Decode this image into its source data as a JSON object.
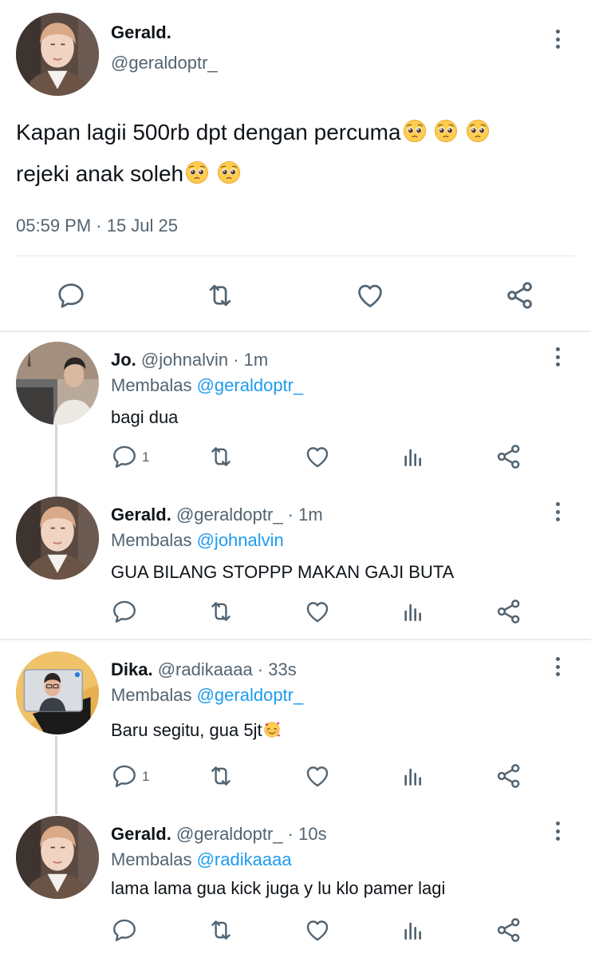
{
  "main_tweet": {
    "name": "Gerald.",
    "handle": "@geraldoptr_",
    "line1": "Kapan lagii 500rb dpt dengan percuma",
    "line2": "rejeki anak soleh",
    "line1_emoji": [
      "pleading-face",
      "pleading-face",
      "pleading-face"
    ],
    "line2_emoji": [
      "pleading-face",
      "pleading-face"
    ],
    "timestamp": "05:59 PM · 15 Jul 25",
    "actions": [
      "reply-icon",
      "retweet-icon",
      "like-icon",
      "share-icon"
    ]
  },
  "replies": [
    {
      "name": "Jo.",
      "meta": "@johnalvin · 1m",
      "replying_label": "Membalas ",
      "replying_to": "@geraldoptr_",
      "text": "bagi dua",
      "reply_count": "1"
    },
    {
      "name": "Gerald.",
      "meta": "@geraldoptr_ · 1m",
      "replying_label": "Membalas ",
      "replying_to": "@johnalvin",
      "text": "GUA BILANG STOPPP MAKAN GAJI BUTA",
      "reply_count": ""
    },
    {
      "name": "Dika.",
      "meta": "@radikaaaa · 33s",
      "replying_label": "Membalas ",
      "replying_to": "@geraldoptr_",
      "text": "Baru segitu, gua 5jt",
      "text_emoji": "smiling-face-with-hearts",
      "reply_count": "1"
    },
    {
      "name": "Gerald.",
      "meta": "@geraldoptr_ · 10s",
      "replying_label": "Membalas ",
      "replying_to": "@radikaaaa",
      "text": "lama lama gua kick juga y lu klo pamer lagi",
      "reply_count": ""
    }
  ],
  "colors": {
    "text": "#0f1419",
    "secondary": "#536471",
    "link": "#1d9bf0",
    "divider": "#e1e8ed"
  }
}
